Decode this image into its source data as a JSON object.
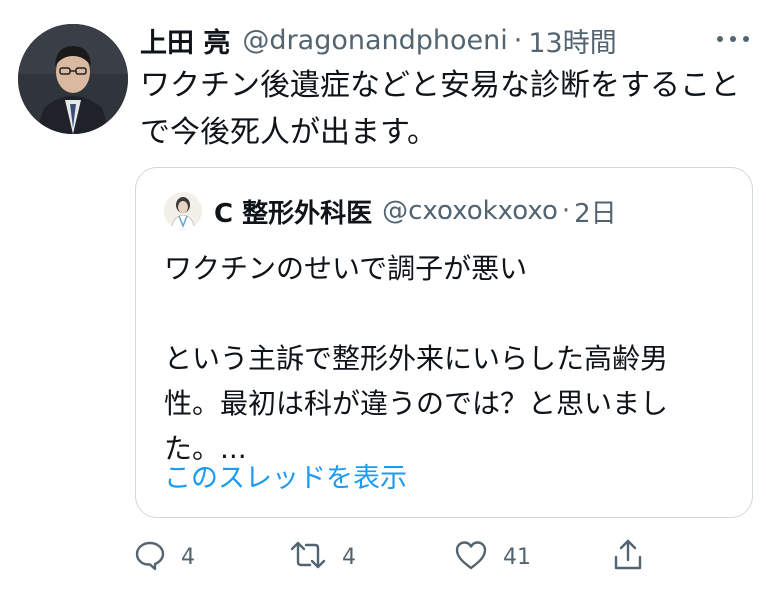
{
  "tweet": {
    "author_name": "上田 亮",
    "author_handle": "@dragonandphoeni",
    "separator": "·",
    "time": "13時間",
    "text_line1": "ワクチン後遺症などと安易な診断をすること",
    "text_line2": "で今後死人が出ます。"
  },
  "quoted": {
    "author_name": "C 整形外科医",
    "author_handle": "@cxoxokxoxo",
    "separator": "·",
    "time": "2日",
    "lines": [
      "ワクチンのせいで調子が悪い",
      "",
      "という主訴で整形外来にいらした高齢男",
      "性。最初は科が違うのでは？と思いまし",
      "た。..."
    ],
    "thread_link": "このスレッドを表示"
  },
  "actions": {
    "reply_count": "4",
    "retweet_count": "4",
    "like_count": "41"
  },
  "icons": {
    "more": "more-horizontal-icon",
    "reply": "reply-icon",
    "retweet": "retweet-icon",
    "like": "heart-icon",
    "share": "share-icon"
  },
  "colors": {
    "text": "#0f1419",
    "secondary": "#536471",
    "link": "#1d9bf0",
    "border": "#cfd9de"
  }
}
